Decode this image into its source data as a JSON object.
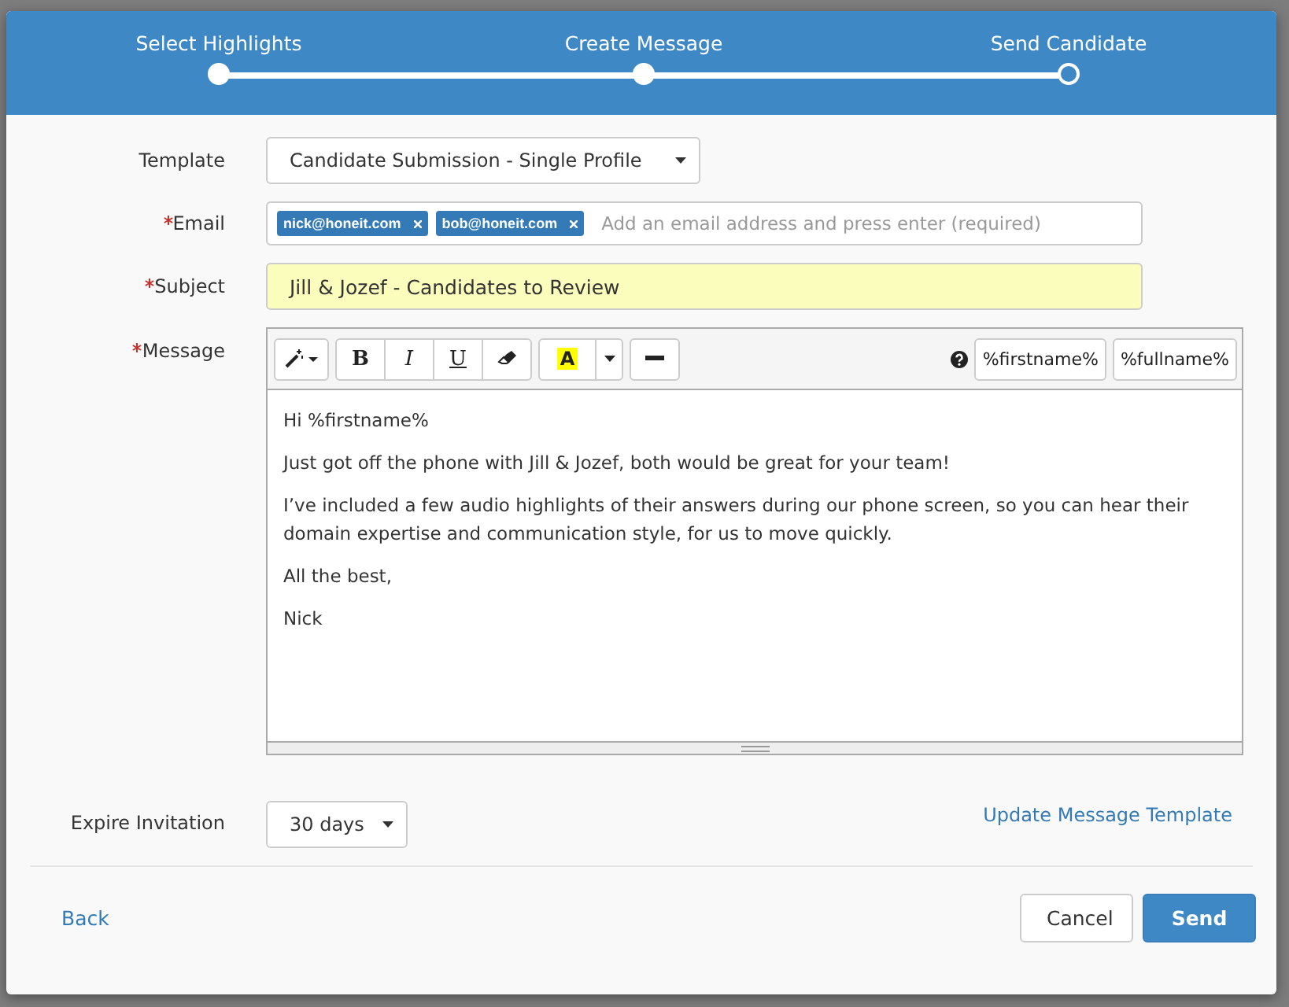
{
  "steps": [
    {
      "label": "Select Highlights",
      "done": true
    },
    {
      "label": "Create Message",
      "done": true
    },
    {
      "label": "Send Candidate",
      "done": false
    }
  ],
  "template": {
    "label": "Template",
    "value": "Candidate Submission - Single Profile"
  },
  "email": {
    "label": "Email",
    "required": true,
    "tags": [
      "nick@honeit.com",
      "bob@honeit.com"
    ],
    "placeholder": "Add an email address and press enter (required)"
  },
  "subject": {
    "label": "Subject",
    "required": true,
    "value": "Jill & Jozef - Candidates to Review"
  },
  "message": {
    "label": "Message",
    "required": true,
    "toolbar": [
      {
        "kind": "wand"
      },
      {
        "kind": "bold",
        "text": "B"
      },
      {
        "kind": "italic",
        "text": "I"
      },
      {
        "kind": "underline",
        "text": "U"
      },
      {
        "kind": "eraser"
      },
      {
        "kind": "highlight",
        "text": "A"
      },
      {
        "kind": "hr"
      }
    ],
    "placeholders": [
      "%firstname%",
      "%fullname%"
    ],
    "paragraphs": [
      "Hi %firstname%",
      "Just got off the phone with Jill & Jozef, both would be great for your team!",
      "I’ve included a few audio highlights of their answers during our phone screen, so you can hear their domain expertise and communication style, for us to move quickly.",
      "All the best,",
      "Nick"
    ]
  },
  "expire": {
    "label": "Expire Invitation",
    "value": "30 days"
  },
  "update_link": "Update Message Template",
  "back": "Back",
  "cancel": "Cancel",
  "send": "Send"
}
